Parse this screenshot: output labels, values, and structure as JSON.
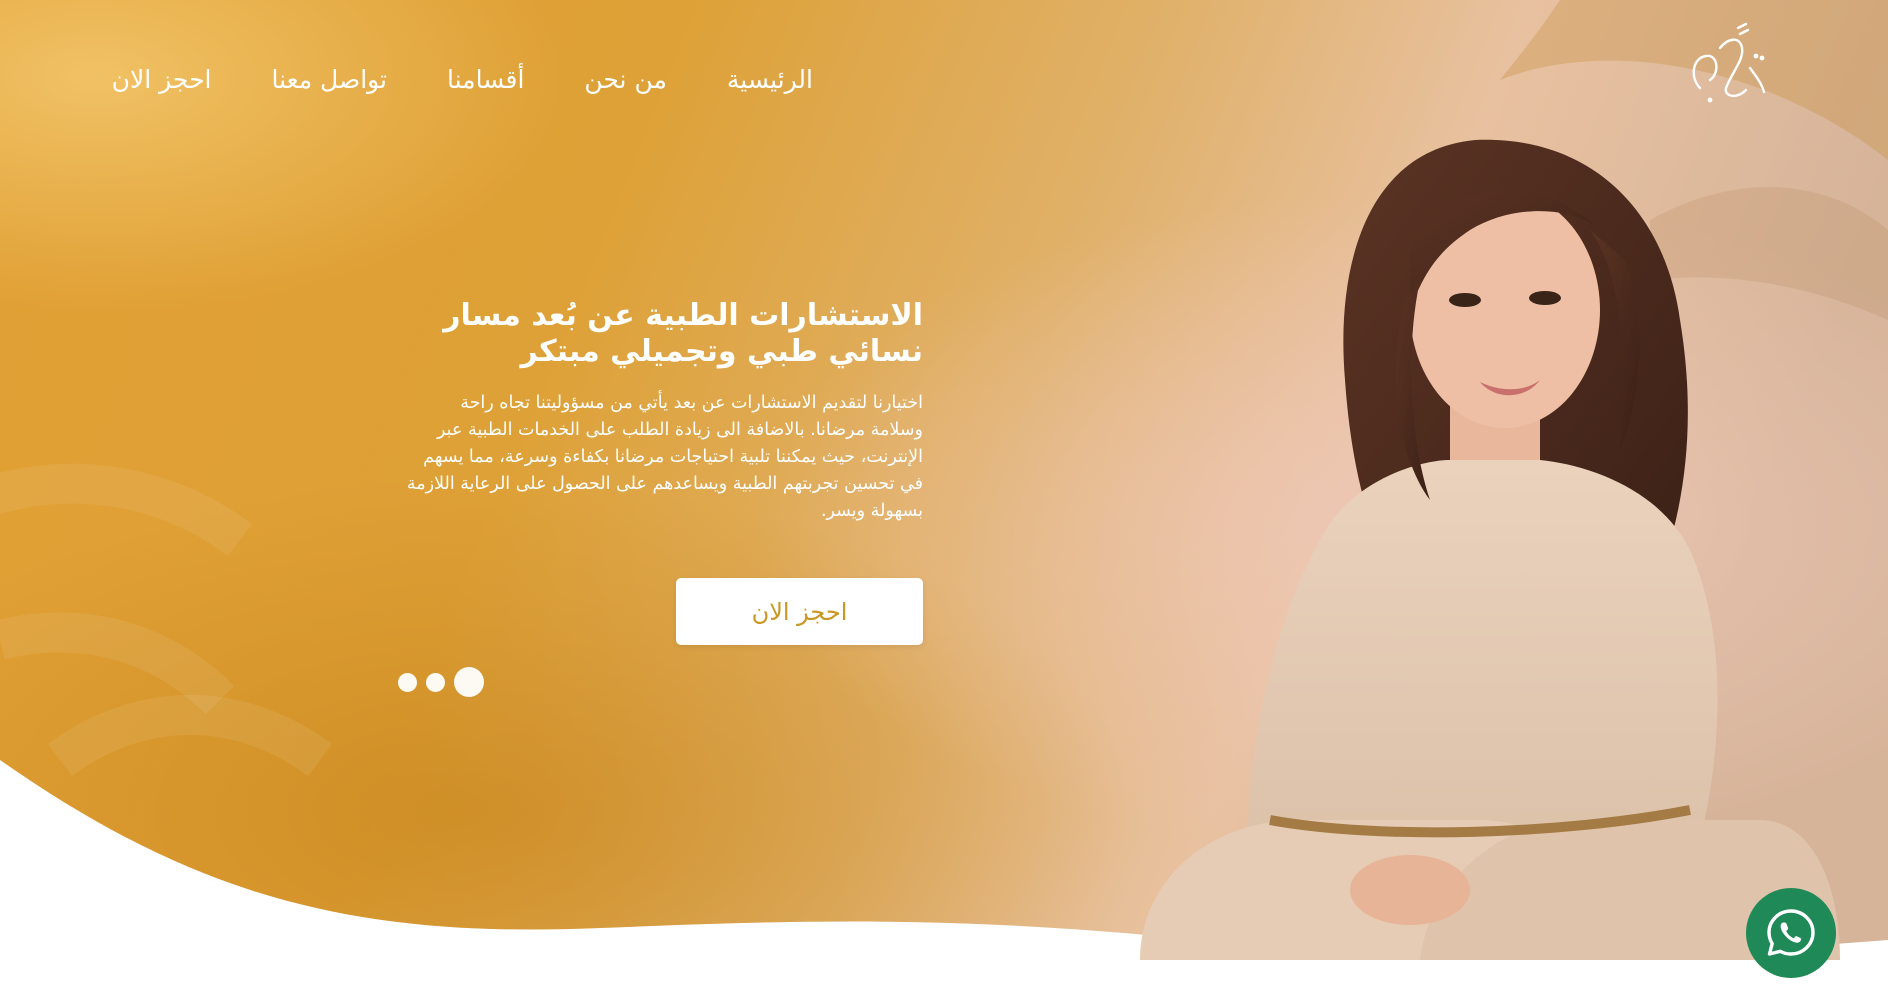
{
  "nav": {
    "home": "الرئيسية",
    "about": "من نحن",
    "departments": "أقسامنا",
    "contact": "تواصل معنا",
    "book": "احجز الان"
  },
  "hero": {
    "title_line1": "الاستشارات الطبية عن بُعد مسار",
    "title_line2": "نسائي طبي وتجميلي مبتكر",
    "description": "اختيارنا لتقديم الاستشارات عن بعد يأتي من مسؤوليتنا تجاه راحة وسلامة مرضانا. بالاضافة الى زيادة الطلب على الخدمات الطبية عبر الإنترنت، حيث يمكننا تلبية احتياجات مرضانا بكفاءة وسرعة، مما يسهم في تحسين تجربتهم الطبية ويساعدهم على الحصول على الرعاية اللازمة بسهولة ويسر.",
    "cta_label": "احجز الان"
  },
  "slider": {
    "count": 3,
    "active_index": 0
  },
  "colors": {
    "gold": "#d9982a",
    "cta_text": "#c99722",
    "whatsapp": "#1f8a57"
  },
  "icons": {
    "logo": "arabic-calligraphy-logo",
    "whatsapp": "whatsapp-icon"
  }
}
